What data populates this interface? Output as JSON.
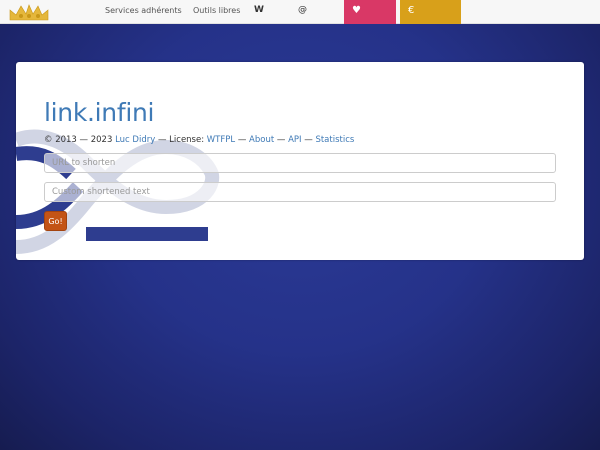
{
  "nav": {
    "services_label": "Services adhérents",
    "outils_label": "Outils libres",
    "wiki_label": "W",
    "contact_label": "@",
    "support_label": "♥",
    "donate_label": "€"
  },
  "main": {
    "title": "link.infini",
    "credits": {
      "copyright": "© 2013 — 2023 ",
      "author": "Luc Didry",
      "sep1": " — License: ",
      "license": "WTFPL",
      "sep2": " — ",
      "about": "About",
      "sep3": " — ",
      "api": "API",
      "sep4": " — ",
      "statistics": "Statistics"
    },
    "url_placeholder": "URL to shorten",
    "custom_placeholder": "Custom shortened text",
    "go_label": "Go!"
  },
  "colors": {
    "accent": "#3f7ab6",
    "support": "#d93866",
    "donate": "#d8a01a",
    "go": "#c35416",
    "background": "#253289"
  }
}
